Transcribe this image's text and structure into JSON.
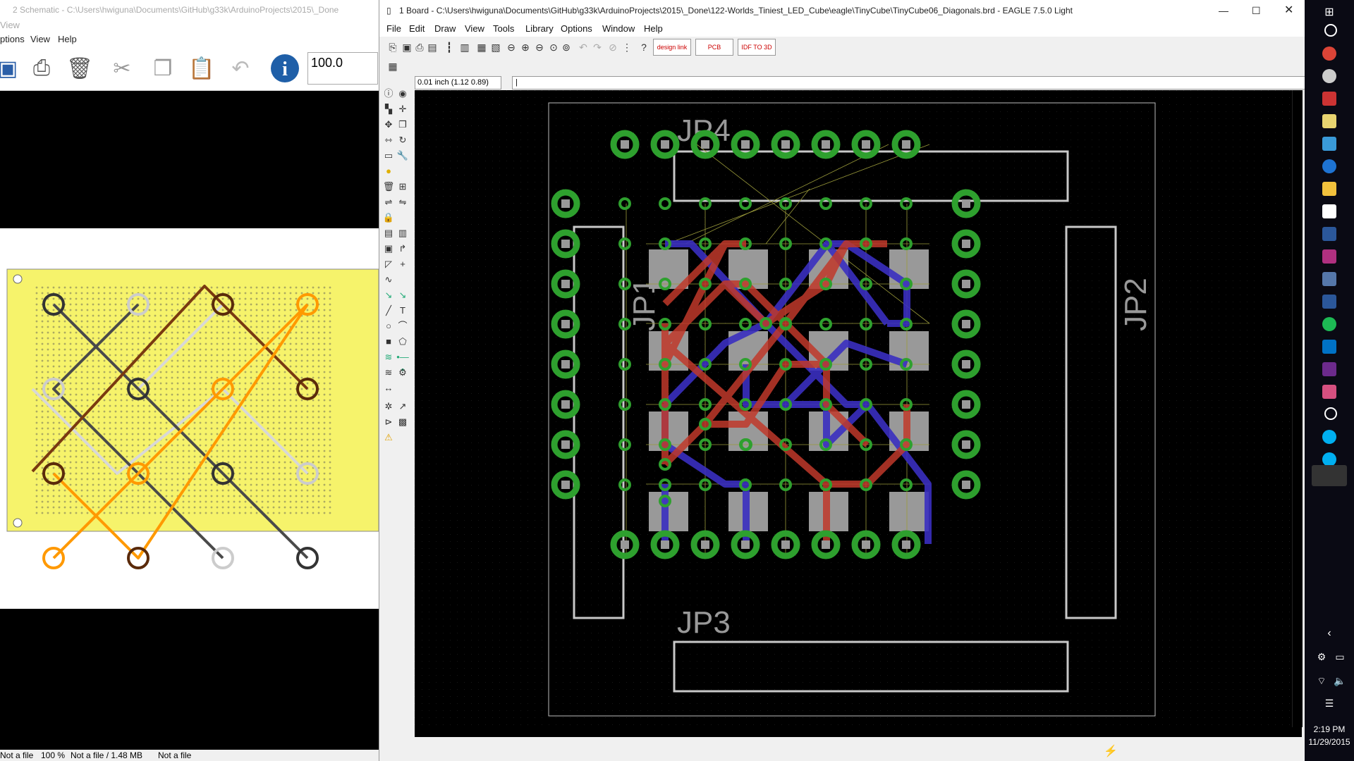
{
  "left_window": {
    "title": "2 Schematic - C:\\Users\\hwiguna\\Documents\\GitHub\\g33k\\ArduinoProjects\\2015\\_Done",
    "view_partial": "View",
    "menu": [
      "ptions",
      "View",
      "Help"
    ],
    "zoom_value": "100.0",
    "status": [
      "Not a file",
      "100 %",
      "Not a file / 1.48 MB",
      "Not a file"
    ]
  },
  "eagle": {
    "title": "1 Board - C:\\Users\\hwiguna\\Documents\\GitHub\\g33k\\ArduinoProjects\\2015\\_Done\\122-Worlds_Tiniest_LED_Cube\\eagle\\TinyCube\\TinyCube06_Diagonals.brd - EAGLE 7.5.0 Light",
    "menu": [
      "File",
      "Edit",
      "Draw",
      "View",
      "Tools",
      "Library",
      "Options",
      "Window",
      "Help"
    ],
    "coord": "0.01 inch (1.12 0.89)",
    "command": "|",
    "buttons": {
      "design_link": "design link",
      "pcb_quote": "PCB QUOTE",
      "idf_to_3d": "IDF TO 3D"
    },
    "labels": {
      "jp4": "JP4",
      "jp1": "JP1",
      "jp2": "JP2",
      "jp3": "JP3"
    },
    "colors": {
      "pad": "#2ea02e",
      "top": "#c0392b",
      "bottom": "#3a2fc0",
      "led": "#999999",
      "outline": "#c8c8c8"
    }
  },
  "taskbar": {
    "time": "2:19 PM",
    "date": "11/29/2015"
  }
}
